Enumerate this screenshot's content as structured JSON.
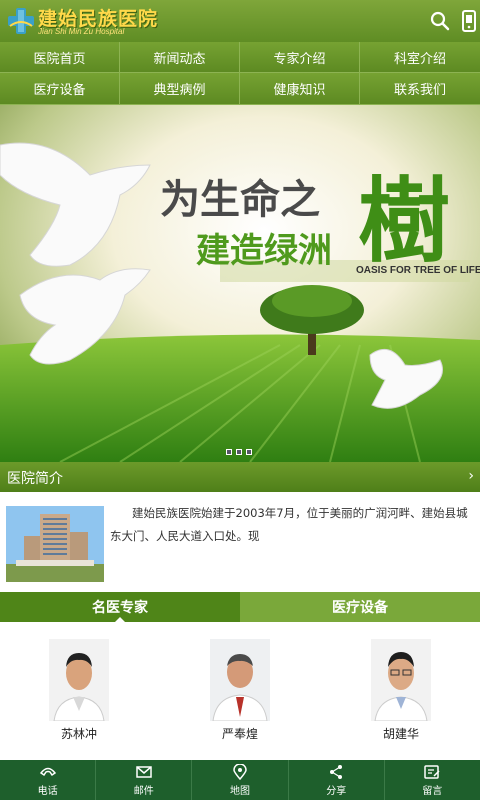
{
  "header": {
    "title": "建始民族医院",
    "subtitle": "Jian Shi Min Zu Hospital",
    "icons": [
      "logo-cross-icon",
      "search-icon",
      "phone-icon"
    ]
  },
  "nav": {
    "items": [
      {
        "label": "医院首页"
      },
      {
        "label": "新闻动态"
      },
      {
        "label": "专家介绍"
      },
      {
        "label": "科室介绍"
      },
      {
        "label": "医疗设备"
      },
      {
        "label": "典型病例"
      },
      {
        "label": "健康知识"
      },
      {
        "label": "联系我们"
      }
    ]
  },
  "banner": {
    "line1": "为生命之",
    "line2": "建造绿洲",
    "big_char": "樹",
    "english": "OASIS FOR TREE OF LIFE",
    "slide_count": 3,
    "active_slide": 1
  },
  "intro": {
    "section_title": "医院简介",
    "arrow": "›",
    "text": "建始民族医院始建于2003年7月，位于美丽的广润河畔、建始县城东大门、人民大道入口处。现"
  },
  "tabs": {
    "active": "名医专家",
    "inactive": "医疗设备"
  },
  "experts": [
    {
      "name": "苏林冲"
    },
    {
      "name": "严奉煌"
    },
    {
      "name": "胡建华"
    }
  ],
  "bottom_bar": {
    "items": [
      {
        "label": "电话",
        "icon": "phone-handset-icon"
      },
      {
        "label": "邮件",
        "icon": "mail-icon"
      },
      {
        "label": "地图",
        "icon": "map-pin-icon"
      },
      {
        "label": "分享",
        "icon": "share-icon"
      },
      {
        "label": "留言",
        "icon": "message-edit-icon"
      }
    ]
  },
  "colors": {
    "primary_green": "#5f8d24",
    "logo_gold": "#ffd94a",
    "bottom_bar": "#1e5f2c",
    "banner_green_text": "#4f9a1d"
  }
}
